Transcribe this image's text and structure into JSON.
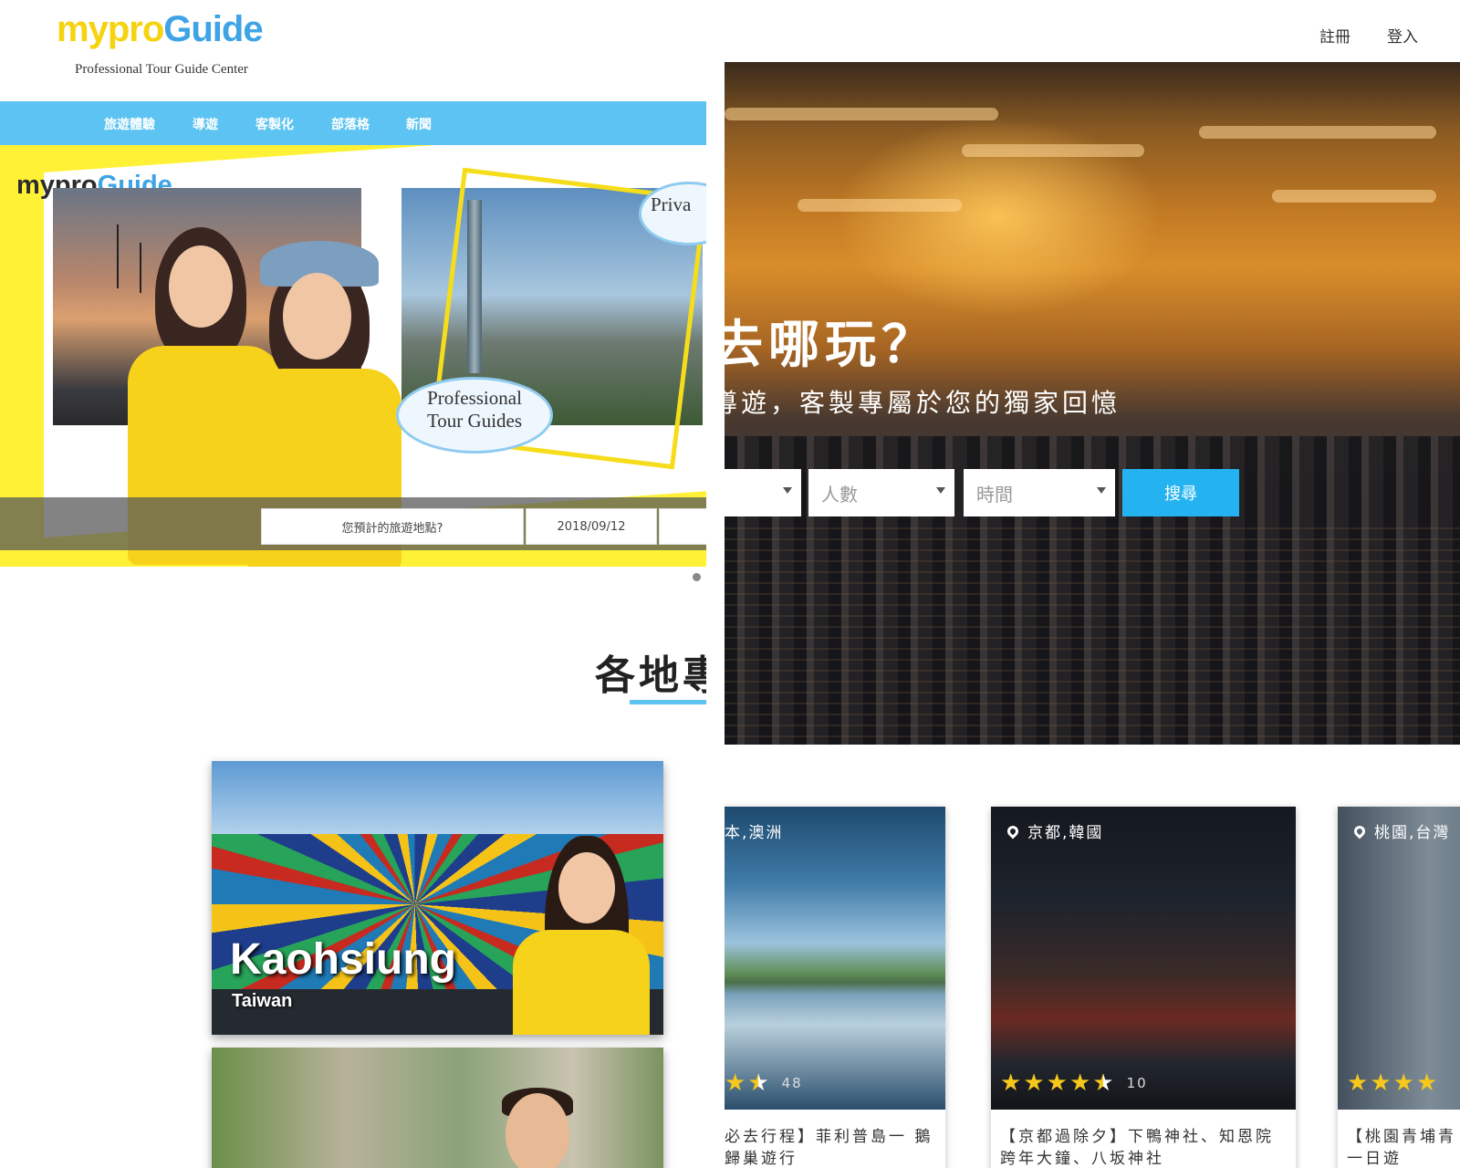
{
  "left": {
    "logo": {
      "part1": "mypro",
      "part2": "Guide",
      "tagline": "Professional Tour Guide Center"
    },
    "nav": [
      {
        "label": "旅遊體驗"
      },
      {
        "label": "導遊"
      },
      {
        "label": "客製化"
      },
      {
        "label": "部落格"
      },
      {
        "label": "新聞"
      }
    ],
    "hero": {
      "logo_part1": "mypro",
      "logo_part2": "Guide",
      "bubble_line1": "Professional",
      "bubble_line2": "Tour Guides",
      "bubble2": "Priva"
    },
    "search": {
      "destination_placeholder": "您預計的旅遊地點?",
      "date_value": "2018/09/12"
    },
    "section_title": "各地專",
    "destinations": [
      {
        "city": "Kaohsiung",
        "country": "Taiwan"
      }
    ]
  },
  "right": {
    "topnav": {
      "register": "註冊",
      "login": "登入"
    },
    "hero": {
      "headline": "去哪玩？",
      "subline": "導遊，客製專屬於您的獨家回憶",
      "people_placeholder": "人數",
      "time_placeholder": "時間",
      "search_button": "搜尋"
    },
    "cards": [
      {
        "location": "本,澳洲",
        "rating_count": "48",
        "title": "必去行程】菲利普島一 鵝歸巢遊行",
        "stars_full": 2,
        "stars_half": 1
      },
      {
        "location": "京都,韓國",
        "rating_count": "10",
        "title": "【京都過除夕】下鴨神社、知恩院跨年大鐘、八坂神社",
        "stars_full": 4,
        "stars_half": 1
      },
      {
        "location": "桃園,台灣",
        "rating_count": "",
        "title": "【桃園青埔青 一日遊",
        "stars_full": 4,
        "stars_half": 0
      }
    ]
  },
  "colors": {
    "brand_yellow": "#f6d21a",
    "brand_blue": "#5cc3f2",
    "search_button": "#24b3f0"
  }
}
